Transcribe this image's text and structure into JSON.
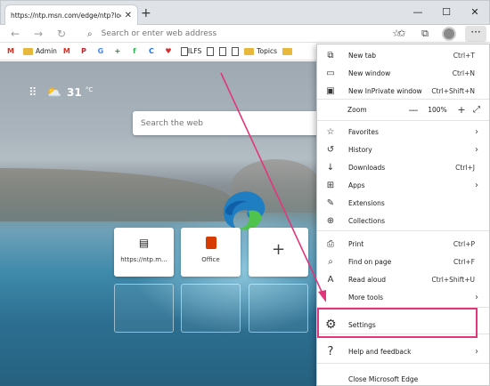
{
  "browser": {
    "tab_title": "https://ntp.msn.com/edge/ntp?locale",
    "tab_close": "✕",
    "new_tab": "+",
    "window_buttons": [
      "—",
      "☐",
      "✕"
    ],
    "address_placeholder": "Search or enter web address",
    "profile_icon": "avatar"
  },
  "favorites_bar": [
    {
      "label": "",
      "icon": "gmail-icon",
      "glyph": "M",
      "color": "#d93025"
    },
    {
      "label": "Admin",
      "icon": "folder-icon"
    },
    {
      "label": "",
      "icon": "gmail-icon",
      "glyph": "M",
      "color": "#d93025"
    },
    {
      "label": "",
      "icon": "pinterest-icon",
      "glyph": "P",
      "color": "#c8232c"
    },
    {
      "label": "",
      "icon": "google-icon",
      "glyph": "G",
      "color": "#4285f4"
    },
    {
      "label": "",
      "icon": "cross-icon",
      "glyph": "+",
      "color": "#1e7e34"
    },
    {
      "label": "",
      "icon": "feedly-icon",
      "glyph": "f",
      "color": "#2bb24c"
    },
    {
      "label": "",
      "icon": "c-icon",
      "glyph": "C",
      "color": "#1a73e8"
    },
    {
      "label": "",
      "icon": "heart-icon",
      "glyph": "♥",
      "color": "#d32f2f"
    },
    {
      "label": "ILFS",
      "icon": "doc-icon"
    },
    {
      "label": "",
      "icon": "doc-icon"
    },
    {
      "label": "",
      "icon": "doc-icon"
    },
    {
      "label": "",
      "icon": "doc-icon"
    },
    {
      "label": "Topics",
      "icon": "folder-icon"
    },
    {
      "label": "",
      "icon": "folder-icon"
    }
  ],
  "ntp": {
    "temperature": "31",
    "temp_unit": "°C",
    "search_placeholder": "Search the web",
    "tiles": [
      {
        "label": "https://ntp.m...",
        "icon": "website-icon"
      },
      {
        "label": "Office",
        "icon": "office-icon"
      },
      {
        "label": "",
        "icon": "add-icon"
      }
    ]
  },
  "menu": {
    "items": [
      {
        "label": "New tab",
        "shortcut": "Ctrl+T",
        "icon": "new-tab-icon",
        "glyph": "⧉"
      },
      {
        "label": "New window",
        "shortcut": "Ctrl+N",
        "icon": "new-window-icon",
        "glyph": "▭"
      },
      {
        "label": "New InPrivate window",
        "shortcut": "Ctrl+Shift+N",
        "icon": "inprivate-icon",
        "glyph": "▣"
      },
      {
        "label": "Favorites",
        "shortcut": "",
        "icon": "favorites-icon",
        "glyph": "☆",
        "arrow": true
      },
      {
        "label": "History",
        "shortcut": "",
        "icon": "history-icon",
        "glyph": "↺",
        "arrow": true
      },
      {
        "label": "Downloads",
        "shortcut": "Ctrl+J",
        "icon": "downloads-icon",
        "glyph": "↓"
      },
      {
        "label": "Apps",
        "shortcut": "",
        "icon": "apps-icon",
        "glyph": "⊞",
        "arrow": true
      },
      {
        "label": "Extensions",
        "shortcut": "",
        "icon": "extensions-icon",
        "glyph": "✎"
      },
      {
        "label": "Collections",
        "shortcut": "",
        "icon": "collections-icon",
        "glyph": "⊕"
      },
      {
        "label": "Print",
        "shortcut": "Ctrl+P",
        "icon": "print-icon",
        "glyph": "⎙"
      },
      {
        "label": "Find on page",
        "shortcut": "Ctrl+F",
        "icon": "find-icon",
        "glyph": "⌕"
      },
      {
        "label": "Read aloud",
        "shortcut": "Ctrl+Shift+U",
        "icon": "read-aloud-icon",
        "glyph": "A"
      },
      {
        "label": "More tools",
        "shortcut": "",
        "icon": "more-tools-icon",
        "glyph": "",
        "arrow": true
      },
      {
        "label": "Settings",
        "shortcut": "",
        "icon": "settings-icon",
        "glyph": "⚙"
      },
      {
        "label": "Help and feedback",
        "shortcut": "",
        "icon": "help-icon",
        "glyph": "?",
        "arrow": true
      },
      {
        "label": "Close Microsoft Edge",
        "shortcut": "",
        "icon": "",
        "glyph": ""
      }
    ],
    "zoom_label": "Zoom",
    "zoom_value": "100%",
    "zoom_minus": "—",
    "zoom_plus": "+",
    "zoom_fullscreen": "⤢"
  },
  "colors": {
    "highlight": "#e3357a",
    "edge_blue": "#1f7ec2",
    "edge_green": "#4fc34d",
    "office_red": "#d83b01"
  }
}
